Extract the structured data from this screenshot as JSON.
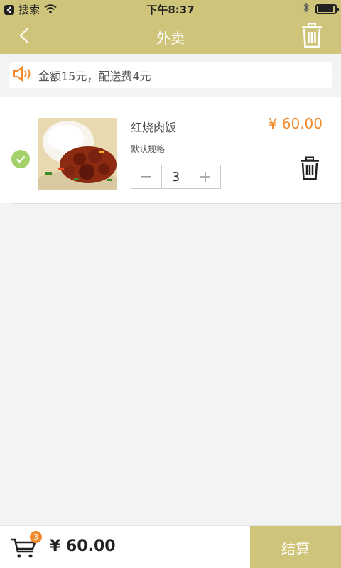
{
  "status_bar": {
    "back_app": "搜索",
    "time": "下午8:37"
  },
  "header": {
    "title": "外卖"
  },
  "notice": {
    "text": "金额15元，配送费4元"
  },
  "cart_items": [
    {
      "name": "红烧肉饭",
      "spec": "默认规格",
      "quantity": "3",
      "price": "¥ 60.00",
      "selected": true
    }
  ],
  "footer": {
    "cart_count": "3",
    "total": "¥ 60.00",
    "checkout_label": "结算"
  },
  "colors": {
    "theme": "#cfc57a",
    "price": "#f08a2c",
    "check": "#a3d26a",
    "badge": "#f08a2c"
  }
}
